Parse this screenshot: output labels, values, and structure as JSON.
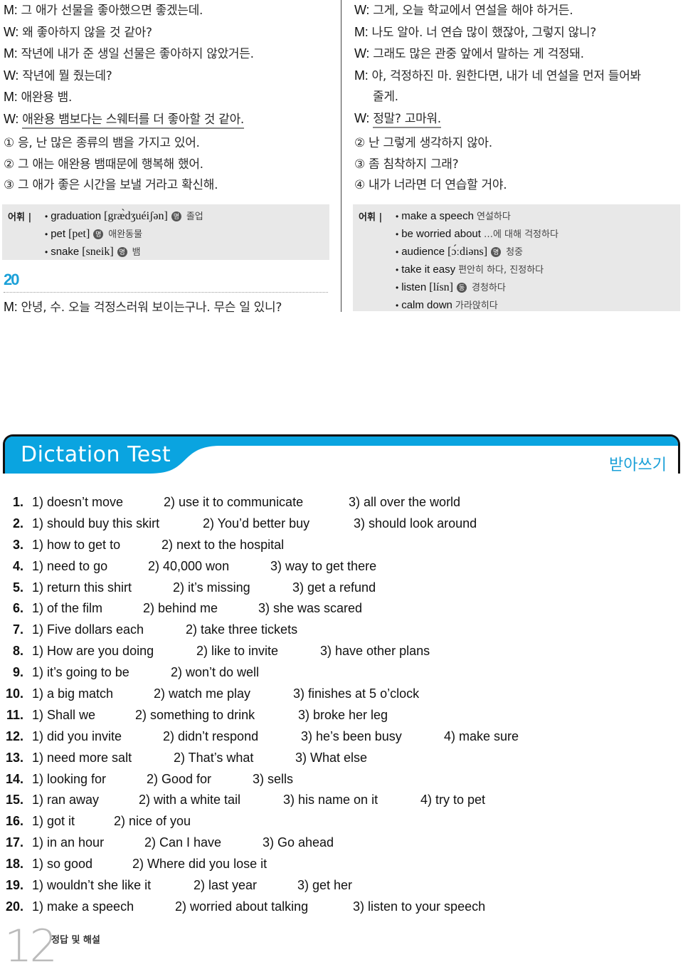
{
  "left_column": {
    "dialogue": [
      {
        "speaker": "M:",
        "text": "그 애가 선물을 좋아했으면 좋겠는데.",
        "underline": false
      },
      {
        "speaker": "W:",
        "text": "왜 좋아하지 않을 것 같아?",
        "underline": false
      },
      {
        "speaker": "M:",
        "text": "작년에 내가 준 생일 선물은 좋아하지 않았거든.",
        "underline": false
      },
      {
        "speaker": "W:",
        "text": "작년에 뭘 줬는데?",
        "underline": false
      },
      {
        "speaker": "M:",
        "text": "애완용 뱀.",
        "underline": false
      },
      {
        "speaker": "W:",
        "text": "애완용 뱀보다는 스웨터를 더 좋아할 것 같아.",
        "underline": true
      }
    ],
    "options": [
      "① 응, 난 많은 종류의 뱀을 가지고 있어.",
      "② 그 애는 애완용 뱀때문에  행복해 했어.",
      "③ 그 애가 좋은 시간을 보낼 거라고 확신해."
    ],
    "vocab": {
      "label": "어휘 |",
      "items": [
        {
          "word": "graduation",
          "ipa": "[grӕ̀dʒuéiʃən]",
          "pos": "명",
          "meaning": "졸업"
        },
        {
          "word": "pet",
          "ipa": "[pet]",
          "pos": "명",
          "meaning": "애완동물"
        },
        {
          "word": "snake",
          "ipa": "[sneik]",
          "pos": "명",
          "meaning": "뱀"
        }
      ]
    },
    "question_number": "20",
    "question_line": {
      "speaker": "M:",
      "text": "안녕, 수. 오늘 걱정스러워 보이는구나. 무슨 일 있니?"
    }
  },
  "right_column": {
    "dialogue": [
      {
        "speaker": "W:",
        "text": "그게, 오늘 학교에서 연설을 해야 하거든."
      },
      {
        "speaker": "M:",
        "text": "나도 알아. 너 연습 많이 했잖아, 그렇지 않니?"
      },
      {
        "speaker": "W:",
        "text": "그래도 많은 관중 앞에서 말하는 게 걱정돼."
      },
      {
        "speaker": "M:",
        "text": "야, 걱정하진 마. 원한다면, 내가 네 연설을 먼저 들어봐"
      },
      {
        "speaker": "",
        "text": "줄게."
      },
      {
        "speaker": "W:",
        "text": "정말? 고마워."
      }
    ],
    "options": [
      "② 난 그렇게 생각하지 않아.",
      "③ 좀 침착하지 그래?",
      "④ 내가 너라면 더 연습할 거야."
    ],
    "vocab": {
      "label": "어휘 |",
      "items": [
        {
          "word": "make a speech",
          "ipa": "",
          "pos": "",
          "meaning": "연설하다"
        },
        {
          "word": "be worried about",
          "ipa": "",
          "pos": "",
          "meaning": "…에 대해 걱정하다"
        },
        {
          "word": "audience",
          "ipa": "[ɔ́ːdiəns]",
          "pos": "명",
          "meaning": "청중"
        },
        {
          "word": "take it easy",
          "ipa": "",
          "pos": "",
          "meaning": "편안히 하다, 진정하다"
        },
        {
          "word": "listen",
          "ipa": "[lísn]",
          "pos": "동",
          "meaning": "경청하다"
        },
        {
          "word": "calm down",
          "ipa": "",
          "pos": "",
          "meaning": "가라앉히다"
        }
      ]
    }
  },
  "dictation": {
    "title": "Dictation Test",
    "subtitle": "받아쓰기",
    "accent_color": "#0aa4e0",
    "answers": [
      {
        "num": "1.",
        "items": [
          "1) doesn’t move",
          "2) use it to communicate",
          "3) all over the world"
        ]
      },
      {
        "num": "2.",
        "items": [
          "1) should buy this skirt",
          "2) You’d better buy",
          "3) should look around"
        ]
      },
      {
        "num": "3.",
        "items": [
          "1) how to get to",
          "2) next to the hospital"
        ]
      },
      {
        "num": "4.",
        "items": [
          "1) need to go",
          "2) 40,000 won",
          "3) way to get there"
        ]
      },
      {
        "num": "5.",
        "items": [
          "1) return this shirt",
          "2) it’s missing",
          "3) get a refund"
        ]
      },
      {
        "num": "6.",
        "items": [
          "1) of the film",
          "2) behind me",
          "3) she was scared"
        ]
      },
      {
        "num": "7.",
        "items": [
          "1) Five dollars each",
          "2) take three tickets"
        ]
      },
      {
        "num": "8.",
        "items": [
          "1) How are you doing",
          "2) like to invite",
          "3) have other plans"
        ]
      },
      {
        "num": "9.",
        "items": [
          "1) it’s going to be",
          "2) won’t do well"
        ]
      },
      {
        "num": "10.",
        "items": [
          "1) a big match",
          "2) watch me play",
          "3) finishes at 5 o’clock"
        ]
      },
      {
        "num": "11.",
        "items": [
          "1) Shall we",
          "2) something to drink",
          "3) broke her leg"
        ]
      },
      {
        "num": "12.",
        "items": [
          "1) did you invite",
          "2) didn’t respond",
          "3) he’s been busy",
          "4) make sure"
        ]
      },
      {
        "num": "13.",
        "items": [
          "1) need more salt",
          "2) That’s what",
          "3) What else"
        ]
      },
      {
        "num": "14.",
        "items": [
          "1) looking for",
          "2) Good for",
          "3) sells"
        ]
      },
      {
        "num": "15.",
        "items": [
          "1) ran away",
          "2) with a white tail",
          "3) his name on it",
          "4) try to pet"
        ]
      },
      {
        "num": "16.",
        "items": [
          "1) got it",
          "2) nice of you"
        ]
      },
      {
        "num": "17.",
        "items": [
          "1) in an hour",
          "2) Can I have",
          "3) Go ahead"
        ]
      },
      {
        "num": "18.",
        "items": [
          "1) so good",
          "2) Where did you lose it"
        ]
      },
      {
        "num": "19.",
        "items": [
          "1) wouldn’t she like it",
          "2) last year",
          "3) get her"
        ]
      },
      {
        "num": "20.",
        "items": [
          "1) make a speech",
          "2) worried about talking",
          "3) listen to your speech"
        ]
      }
    ]
  },
  "footer": {
    "page_number": "12",
    "section": "정답 및 해설"
  }
}
